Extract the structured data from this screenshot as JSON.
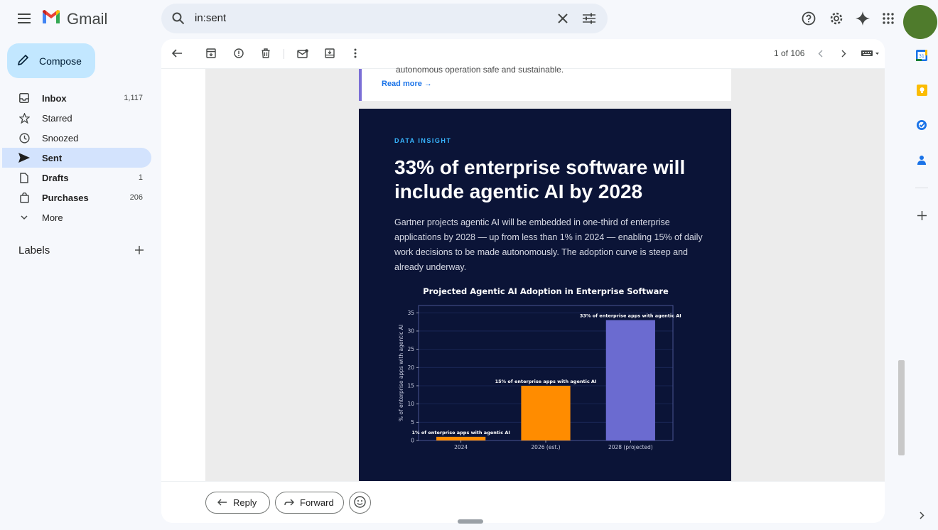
{
  "app": {
    "name": "Gmail"
  },
  "search": {
    "query": "in:sent"
  },
  "compose_label": "Compose",
  "nav": [
    {
      "label": "Inbox",
      "count": "1,117"
    },
    {
      "label": "Starred",
      "count": ""
    },
    {
      "label": "Snoozed",
      "count": ""
    },
    {
      "label": "Sent",
      "count": ""
    },
    {
      "label": "Drafts",
      "count": "1"
    },
    {
      "label": "Purchases",
      "count": "206"
    },
    {
      "label": "More",
      "count": ""
    }
  ],
  "labels": {
    "heading": "Labels"
  },
  "pager": {
    "text": "1 of 106"
  },
  "email": {
    "quote_tail": "autonomous operation safe and sustainable.",
    "read_more": "Read more →",
    "tag": "DATA INSIGHT",
    "headline": "33% of enterprise software will include agentic AI by 2028",
    "body": "Gartner projects agentic AI will be embedded in one-third of enterprise applications by 2028 — up from less than 1% in 2024 — enabling 15% of daily work decisions to be made autonomously. The adoption curve is steep and already underway."
  },
  "chart_data": {
    "type": "bar",
    "title": "Projected Agentic AI Adoption in Enterprise Software",
    "xlabel": "",
    "ylabel": "% of enterprise apps with agentic AI",
    "categories": [
      "2024",
      "2026 (est.)",
      "2028 (projected)"
    ],
    "values": [
      1,
      15,
      33
    ],
    "data_labels": [
      "1% of enterprise apps with agentic AI",
      "15% of enterprise apps with agentic AI",
      "33% of enterprise apps with agentic AI"
    ],
    "bar_colors": [
      "#ff8c00",
      "#ff8c00",
      "#6b6bd0"
    ],
    "ylim": [
      0,
      37
    ],
    "yticks": [
      0,
      5,
      10,
      15,
      20,
      25,
      30,
      35
    ],
    "grid": true,
    "legend": "none"
  },
  "reply": {
    "reply_label": "Reply",
    "forward_label": "Forward"
  },
  "colors": {
    "sent_active": "#d3e3fd",
    "compose": "#c2e7ff",
    "email_dark": "#0b1437",
    "accent_blue": "#38b6ff"
  }
}
